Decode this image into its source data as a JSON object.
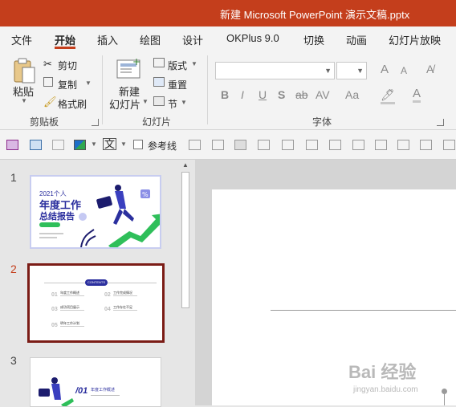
{
  "window": {
    "title": "新建 Microsoft PowerPoint 演示文稿.pptx"
  },
  "tabs": [
    "文件",
    "开始",
    "插入",
    "绘图",
    "设计",
    "OKPlus 9.0",
    "切换",
    "动画",
    "幻灯片放映"
  ],
  "ribbon": {
    "clipboard": {
      "paste": "粘贴",
      "cut": "剪切",
      "copy": "复制",
      "format_painter": "格式刷",
      "group_label": "剪贴板"
    },
    "slides": {
      "new_slide_line1": "新建",
      "new_slide_line2": "幻灯片",
      "layout": "版式",
      "reset": "重置",
      "section": "节",
      "group_label": "幻灯片"
    },
    "font": {
      "bold": "B",
      "italic": "I",
      "underline": "U",
      "shadow": "S",
      "strike": "ab",
      "spacing": "AV",
      "case": "Aa",
      "grow": "A",
      "shrink": "A",
      "group_label": "字体"
    }
  },
  "qat": {
    "guides_label": "参考线"
  },
  "slides": [
    {
      "number": "1",
      "sub": "2021个人",
      "title1": "年度工作",
      "title2": "总结报告"
    },
    {
      "number": "2",
      "header": "CONTENTS",
      "items": [
        {
          "num": "01",
          "label": "年度工作概述"
        },
        {
          "num": "02",
          "label": "工作完成情况"
        },
        {
          "num": "03",
          "label": "成功项目展示"
        },
        {
          "num": "04",
          "label": "工作存在不足"
        },
        {
          "num": "05",
          "label": "明年工作计划"
        }
      ]
    },
    {
      "number": "3",
      "num": "/01",
      "label": "年度工作概述"
    }
  ],
  "watermark": {
    "text": "Bai 经验",
    "sub": "jingyan.baidu.com"
  },
  "colors": {
    "titlebar": "#c43e1c",
    "selected_border": "#7b1c16",
    "thumb_blue": "#2b2f9e",
    "thumb_green": "#2fbf5a"
  }
}
